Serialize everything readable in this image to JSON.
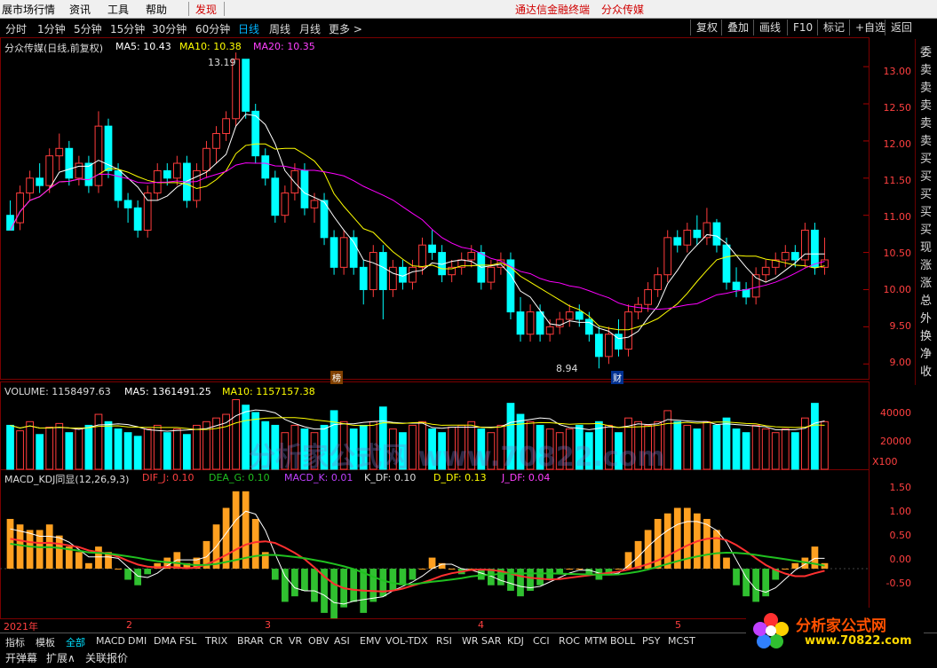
{
  "menu": {
    "items": [
      "展市场行情",
      "资讯",
      "工具",
      "帮助"
    ],
    "highlight": "发现",
    "terminal_name": "通达信金融终端",
    "stock_name": "分众传媒"
  },
  "periods": [
    "分时",
    "1分钟",
    "5分钟",
    "15分钟",
    "30分钟",
    "60分钟",
    "日线",
    "周线",
    "月线",
    "更多 >"
  ],
  "active_period": "日线",
  "right_buttons": [
    "复权",
    "叠加",
    "画线",
    "F10",
    "标记",
    "+自选",
    "返回"
  ],
  "side_labels": [
    "委",
    "卖",
    "卖",
    "卖",
    "卖",
    "卖",
    "买",
    "买",
    "买",
    "买",
    "买",
    "现",
    "涨",
    "涨",
    "总",
    "外",
    "换",
    "净",
    "收"
  ],
  "main_chart": {
    "title": "分众传媒(日线,前复权)",
    "ma5_label": "MA5: 10.43",
    "ma10_label": "MA10: 10.38",
    "ma20_label": "MA20: 10.35",
    "max_label": "13.19",
    "min_label": "8.94",
    "y_ticks": [
      "13.00",
      "12.50",
      "12.00",
      "11.50",
      "11.00",
      "10.50",
      "10.00",
      "9.50",
      "9.00"
    ],
    "badge_bang": "榜",
    "badge_cai": "财"
  },
  "volume_chart": {
    "title": "VOLUME: 1158497.63",
    "ma5_label": "MA5: 1361491.25",
    "ma10_label": "MA10: 1157157.38",
    "y_ticks": [
      "40000",
      "20000"
    ],
    "unit": "X100"
  },
  "macd_chart": {
    "title": "MACD_KDJ同显(12,26,9,3)",
    "dif_j": "DIF_J: 0.10",
    "dea_g": "DEA_G: 0.10",
    "macd_k": "MACD_K: 0.01",
    "k_df": "K_DF: 0.10",
    "d_df": "D_DF: 0.13",
    "j_df": "J_DF: 0.04",
    "y_ticks": [
      "1.50",
      "1.00",
      "0.50",
      "0.00",
      "-0.50"
    ]
  },
  "x_axis": {
    "labels": [
      "2021年",
      "2",
      "3",
      "4",
      "5"
    ]
  },
  "indicator_tabs": [
    "指标",
    "模板",
    "全部",
    "MACD",
    "DMI",
    "DMA",
    "FSL",
    "TRIX",
    "BRAR",
    "CR",
    "VR",
    "OBV",
    "ASI",
    "EMV",
    "VOL-TDX",
    "RSI",
    "WR",
    "SAR",
    "KDJ",
    "CCI",
    "ROC",
    "MTM",
    "BOLL",
    "PSY",
    "MCST"
  ],
  "active_indicator_tab": "全部",
  "status_tabs": [
    "开弹幕",
    "扩展∧",
    "关联报价"
  ],
  "logo": {
    "name": "分析家公式网",
    "url": "www.70822.com"
  },
  "watermark": "分析家公式网 www.70822.com",
  "colors": {
    "up": "#ff3c3c",
    "down": "#00ffff",
    "ma5": "#ffffff",
    "ma10": "#ffff00",
    "ma20": "#ff00ff",
    "accent": "#00b4ff",
    "brand_red": "#d00000"
  },
  "chart_data": {
    "type": "candlestick",
    "title": "分众传媒(日线,前复权)",
    "ylim": [
      8.8,
      13.3
    ],
    "ohlc": [
      [
        11.0,
        11.2,
        10.8,
        10.8
      ],
      [
        10.9,
        11.4,
        10.8,
        11.3
      ],
      [
        11.3,
        11.6,
        11.2,
        11.5
      ],
      [
        11.5,
        11.7,
        11.3,
        11.4
      ],
      [
        11.4,
        11.9,
        11.3,
        11.8
      ],
      [
        11.8,
        12.1,
        11.6,
        11.9
      ],
      [
        11.9,
        12.0,
        11.4,
        11.5
      ],
      [
        11.5,
        11.8,
        11.4,
        11.7
      ],
      [
        11.7,
        11.8,
        11.3,
        11.4
      ],
      [
        11.4,
        12.4,
        11.3,
        12.2
      ],
      [
        12.2,
        12.3,
        11.5,
        11.6
      ],
      [
        11.6,
        11.7,
        11.1,
        11.2
      ],
      [
        11.2,
        11.3,
        10.9,
        11.1
      ],
      [
        11.1,
        11.2,
        10.7,
        10.8
      ],
      [
        10.8,
        11.4,
        10.7,
        11.3
      ],
      [
        11.3,
        11.7,
        11.2,
        11.6
      ],
      [
        11.6,
        11.7,
        11.4,
        11.5
      ],
      [
        11.5,
        11.8,
        11.4,
        11.7
      ],
      [
        11.7,
        11.8,
        11.1,
        11.2
      ],
      [
        11.2,
        11.7,
        11.1,
        11.6
      ],
      [
        11.6,
        12.0,
        11.5,
        11.9
      ],
      [
        11.9,
        12.2,
        11.7,
        12.1
      ],
      [
        12.1,
        12.4,
        12.0,
        12.3
      ],
      [
        12.3,
        13.19,
        12.2,
        13.1
      ],
      [
        13.1,
        13.1,
        12.3,
        12.4
      ],
      [
        12.4,
        12.5,
        11.7,
        11.8
      ],
      [
        11.8,
        11.9,
        11.4,
        11.5
      ],
      [
        11.5,
        11.6,
        10.9,
        11.0
      ],
      [
        11.0,
        11.4,
        10.9,
        11.3
      ],
      [
        11.3,
        11.7,
        11.2,
        11.6
      ],
      [
        11.6,
        11.7,
        11.0,
        11.1
      ],
      [
        11.1,
        11.3,
        10.9,
        11.2
      ],
      [
        11.2,
        11.3,
        10.6,
        10.7
      ],
      [
        10.7,
        10.8,
        10.2,
        10.3
      ],
      [
        10.3,
        10.8,
        10.2,
        10.7
      ],
      [
        10.7,
        10.8,
        10.2,
        10.3
      ],
      [
        10.3,
        10.4,
        9.8,
        10.0
      ],
      [
        10.0,
        10.6,
        9.9,
        10.5
      ],
      [
        10.5,
        10.6,
        9.6,
        10.0
      ],
      [
        10.0,
        10.4,
        9.9,
        10.3
      ],
      [
        10.3,
        10.4,
        10.0,
        10.1
      ],
      [
        10.1,
        10.4,
        10.0,
        10.3
      ],
      [
        10.3,
        10.7,
        10.2,
        10.6
      ],
      [
        10.6,
        10.8,
        10.4,
        10.5
      ],
      [
        10.5,
        10.6,
        10.1,
        10.2
      ],
      [
        10.2,
        10.4,
        10.1,
        10.3
      ],
      [
        10.3,
        10.5,
        10.2,
        10.4
      ],
      [
        10.4,
        10.6,
        10.3,
        10.5
      ],
      [
        10.5,
        10.6,
        10.0,
        10.1
      ],
      [
        10.1,
        10.4,
        10.0,
        10.3
      ],
      [
        10.3,
        10.5,
        10.2,
        10.4
      ],
      [
        10.4,
        10.5,
        9.6,
        9.7
      ],
      [
        9.7,
        9.9,
        9.3,
        9.4
      ],
      [
        9.4,
        9.8,
        9.3,
        9.7
      ],
      [
        9.7,
        9.8,
        9.3,
        9.4
      ],
      [
        9.4,
        9.6,
        9.3,
        9.5
      ],
      [
        9.5,
        9.7,
        9.4,
        9.6
      ],
      [
        9.6,
        9.8,
        9.5,
        9.7
      ],
      [
        9.7,
        9.8,
        9.5,
        9.6
      ],
      [
        9.6,
        9.7,
        9.3,
        9.4
      ],
      [
        9.4,
        9.5,
        8.94,
        9.1
      ],
      [
        9.1,
        9.5,
        9.0,
        9.4
      ],
      [
        9.4,
        9.6,
        9.1,
        9.2
      ],
      [
        9.2,
        9.8,
        9.1,
        9.7
      ],
      [
        9.7,
        9.9,
        9.6,
        9.8
      ],
      [
        9.8,
        10.1,
        9.7,
        10.0
      ],
      [
        10.0,
        10.3,
        9.9,
        10.2
      ],
      [
        10.2,
        10.8,
        10.1,
        10.7
      ],
      [
        10.7,
        10.8,
        10.5,
        10.6
      ],
      [
        10.6,
        10.9,
        10.5,
        10.8
      ],
      [
        10.8,
        11.0,
        10.6,
        10.7
      ],
      [
        10.7,
        11.1,
        10.6,
        10.9
      ],
      [
        10.9,
        10.95,
        10.5,
        10.6
      ],
      [
        10.6,
        10.7,
        10.0,
        10.1
      ],
      [
        10.1,
        10.3,
        9.9,
        10.0
      ],
      [
        10.0,
        10.1,
        9.8,
        9.9
      ],
      [
        9.9,
        10.3,
        9.8,
        10.2
      ],
      [
        10.2,
        10.4,
        10.1,
        10.3
      ],
      [
        10.3,
        10.5,
        10.2,
        10.4
      ],
      [
        10.4,
        10.6,
        10.3,
        10.5
      ],
      [
        10.5,
        10.6,
        10.3,
        10.4
      ],
      [
        10.4,
        10.9,
        10.3,
        10.8
      ],
      [
        10.8,
        10.9,
        10.2,
        10.3
      ],
      [
        10.3,
        10.7,
        10.2,
        10.4
      ]
    ],
    "volume": [
      2.4,
      2.1,
      2.6,
      1.9,
      2.3,
      2.5,
      2.0,
      2.2,
      2.4,
      3.0,
      2.6,
      2.2,
      2.0,
      1.8,
      2.2,
      2.4,
      2.0,
      2.2,
      1.9,
      2.4,
      2.6,
      2.8,
      3.0,
      3.8,
      3.5,
      3.1,
      2.6,
      2.4,
      2.0,
      2.4,
      2.2,
      2.0,
      2.4,
      3.2,
      2.6,
      2.2,
      2.4,
      2.6,
      3.4,
      2.2,
      2.0,
      2.4,
      2.6,
      2.2,
      2.0,
      2.3,
      2.4,
      2.6,
      2.2,
      2.0,
      2.4,
      3.6,
      3.0,
      2.6,
      2.4,
      2.2,
      2.0,
      2.2,
      2.4,
      2.0,
      2.6,
      2.4,
      2.0,
      2.8,
      2.6,
      2.4,
      2.6,
      3.2,
      2.6,
      2.4,
      2.2,
      2.6,
      2.4,
      2.8,
      2.2,
      2.0,
      2.4,
      2.2,
      2.0,
      2.2,
      2.0,
      2.8,
      3.6,
      2.6
    ],
    "macd": [
      0.9,
      0.8,
      0.7,
      0.7,
      0.8,
      0.6,
      0.4,
      0.3,
      0.1,
      0.4,
      0.3,
      0.0,
      -0.2,
      -0.3,
      -0.1,
      0.1,
      0.2,
      0.3,
      0.1,
      0.2,
      0.5,
      0.8,
      1.1,
      1.4,
      1.4,
      0.9,
      0.3,
      -0.2,
      -0.6,
      -0.5,
      -0.4,
      -0.6,
      -0.8,
      -0.9,
      -0.7,
      -0.6,
      -0.8,
      -0.6,
      -0.5,
      -0.4,
      -0.3,
      -0.2,
      0.0,
      0.2,
      0.1,
      0.0,
      -0.1,
      0.0,
      -0.2,
      -0.3,
      -0.3,
      -0.4,
      -0.5,
      -0.4,
      -0.3,
      -0.2,
      -0.1,
      0.0,
      0.0,
      -0.1,
      -0.2,
      -0.1,
      0.0,
      0.3,
      0.5,
      0.7,
      0.9,
      1.0,
      1.1,
      1.1,
      1.0,
      0.9,
      0.7,
      0.2,
      -0.3,
      -0.5,
      -0.6,
      -0.5,
      -0.2,
      0.0,
      0.1,
      0.2,
      0.4,
      0.1
    ]
  }
}
